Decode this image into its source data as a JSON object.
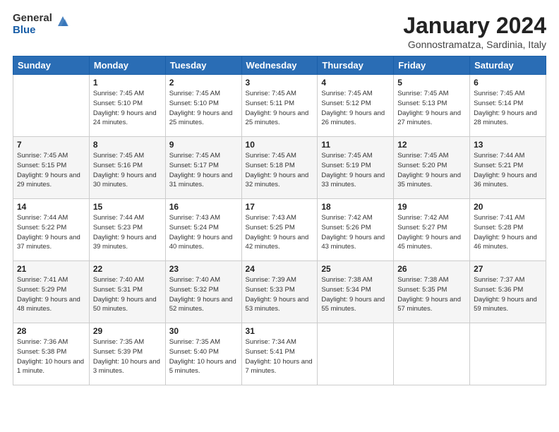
{
  "logo": {
    "general": "General",
    "blue": "Blue"
  },
  "title": "January 2024",
  "subtitle": "Gonnostramatza, Sardinia, Italy",
  "headers": [
    "Sunday",
    "Monday",
    "Tuesday",
    "Wednesday",
    "Thursday",
    "Friday",
    "Saturday"
  ],
  "weeks": [
    [
      {
        "num": "",
        "sunrise": "",
        "sunset": "",
        "daylight": ""
      },
      {
        "num": "1",
        "sunrise": "Sunrise: 7:45 AM",
        "sunset": "Sunset: 5:10 PM",
        "daylight": "Daylight: 9 hours and 24 minutes."
      },
      {
        "num": "2",
        "sunrise": "Sunrise: 7:45 AM",
        "sunset": "Sunset: 5:10 PM",
        "daylight": "Daylight: 9 hours and 25 minutes."
      },
      {
        "num": "3",
        "sunrise": "Sunrise: 7:45 AM",
        "sunset": "Sunset: 5:11 PM",
        "daylight": "Daylight: 9 hours and 25 minutes."
      },
      {
        "num": "4",
        "sunrise": "Sunrise: 7:45 AM",
        "sunset": "Sunset: 5:12 PM",
        "daylight": "Daylight: 9 hours and 26 minutes."
      },
      {
        "num": "5",
        "sunrise": "Sunrise: 7:45 AM",
        "sunset": "Sunset: 5:13 PM",
        "daylight": "Daylight: 9 hours and 27 minutes."
      },
      {
        "num": "6",
        "sunrise": "Sunrise: 7:45 AM",
        "sunset": "Sunset: 5:14 PM",
        "daylight": "Daylight: 9 hours and 28 minutes."
      }
    ],
    [
      {
        "num": "7",
        "sunrise": "Sunrise: 7:45 AM",
        "sunset": "Sunset: 5:15 PM",
        "daylight": "Daylight: 9 hours and 29 minutes."
      },
      {
        "num": "8",
        "sunrise": "Sunrise: 7:45 AM",
        "sunset": "Sunset: 5:16 PM",
        "daylight": "Daylight: 9 hours and 30 minutes."
      },
      {
        "num": "9",
        "sunrise": "Sunrise: 7:45 AM",
        "sunset": "Sunset: 5:17 PM",
        "daylight": "Daylight: 9 hours and 31 minutes."
      },
      {
        "num": "10",
        "sunrise": "Sunrise: 7:45 AM",
        "sunset": "Sunset: 5:18 PM",
        "daylight": "Daylight: 9 hours and 32 minutes."
      },
      {
        "num": "11",
        "sunrise": "Sunrise: 7:45 AM",
        "sunset": "Sunset: 5:19 PM",
        "daylight": "Daylight: 9 hours and 33 minutes."
      },
      {
        "num": "12",
        "sunrise": "Sunrise: 7:45 AM",
        "sunset": "Sunset: 5:20 PM",
        "daylight": "Daylight: 9 hours and 35 minutes."
      },
      {
        "num": "13",
        "sunrise": "Sunrise: 7:44 AM",
        "sunset": "Sunset: 5:21 PM",
        "daylight": "Daylight: 9 hours and 36 minutes."
      }
    ],
    [
      {
        "num": "14",
        "sunrise": "Sunrise: 7:44 AM",
        "sunset": "Sunset: 5:22 PM",
        "daylight": "Daylight: 9 hours and 37 minutes."
      },
      {
        "num": "15",
        "sunrise": "Sunrise: 7:44 AM",
        "sunset": "Sunset: 5:23 PM",
        "daylight": "Daylight: 9 hours and 39 minutes."
      },
      {
        "num": "16",
        "sunrise": "Sunrise: 7:43 AM",
        "sunset": "Sunset: 5:24 PM",
        "daylight": "Daylight: 9 hours and 40 minutes."
      },
      {
        "num": "17",
        "sunrise": "Sunrise: 7:43 AM",
        "sunset": "Sunset: 5:25 PM",
        "daylight": "Daylight: 9 hours and 42 minutes."
      },
      {
        "num": "18",
        "sunrise": "Sunrise: 7:42 AM",
        "sunset": "Sunset: 5:26 PM",
        "daylight": "Daylight: 9 hours and 43 minutes."
      },
      {
        "num": "19",
        "sunrise": "Sunrise: 7:42 AM",
        "sunset": "Sunset: 5:27 PM",
        "daylight": "Daylight: 9 hours and 45 minutes."
      },
      {
        "num": "20",
        "sunrise": "Sunrise: 7:41 AM",
        "sunset": "Sunset: 5:28 PM",
        "daylight": "Daylight: 9 hours and 46 minutes."
      }
    ],
    [
      {
        "num": "21",
        "sunrise": "Sunrise: 7:41 AM",
        "sunset": "Sunset: 5:29 PM",
        "daylight": "Daylight: 9 hours and 48 minutes."
      },
      {
        "num": "22",
        "sunrise": "Sunrise: 7:40 AM",
        "sunset": "Sunset: 5:31 PM",
        "daylight": "Daylight: 9 hours and 50 minutes."
      },
      {
        "num": "23",
        "sunrise": "Sunrise: 7:40 AM",
        "sunset": "Sunset: 5:32 PM",
        "daylight": "Daylight: 9 hours and 52 minutes."
      },
      {
        "num": "24",
        "sunrise": "Sunrise: 7:39 AM",
        "sunset": "Sunset: 5:33 PM",
        "daylight": "Daylight: 9 hours and 53 minutes."
      },
      {
        "num": "25",
        "sunrise": "Sunrise: 7:38 AM",
        "sunset": "Sunset: 5:34 PM",
        "daylight": "Daylight: 9 hours and 55 minutes."
      },
      {
        "num": "26",
        "sunrise": "Sunrise: 7:38 AM",
        "sunset": "Sunset: 5:35 PM",
        "daylight": "Daylight: 9 hours and 57 minutes."
      },
      {
        "num": "27",
        "sunrise": "Sunrise: 7:37 AM",
        "sunset": "Sunset: 5:36 PM",
        "daylight": "Daylight: 9 hours and 59 minutes."
      }
    ],
    [
      {
        "num": "28",
        "sunrise": "Sunrise: 7:36 AM",
        "sunset": "Sunset: 5:38 PM",
        "daylight": "Daylight: 10 hours and 1 minute."
      },
      {
        "num": "29",
        "sunrise": "Sunrise: 7:35 AM",
        "sunset": "Sunset: 5:39 PM",
        "daylight": "Daylight: 10 hours and 3 minutes."
      },
      {
        "num": "30",
        "sunrise": "Sunrise: 7:35 AM",
        "sunset": "Sunset: 5:40 PM",
        "daylight": "Daylight: 10 hours and 5 minutes."
      },
      {
        "num": "31",
        "sunrise": "Sunrise: 7:34 AM",
        "sunset": "Sunset: 5:41 PM",
        "daylight": "Daylight: 10 hours and 7 minutes."
      },
      {
        "num": "",
        "sunrise": "",
        "sunset": "",
        "daylight": ""
      },
      {
        "num": "",
        "sunrise": "",
        "sunset": "",
        "daylight": ""
      },
      {
        "num": "",
        "sunrise": "",
        "sunset": "",
        "daylight": ""
      }
    ]
  ]
}
